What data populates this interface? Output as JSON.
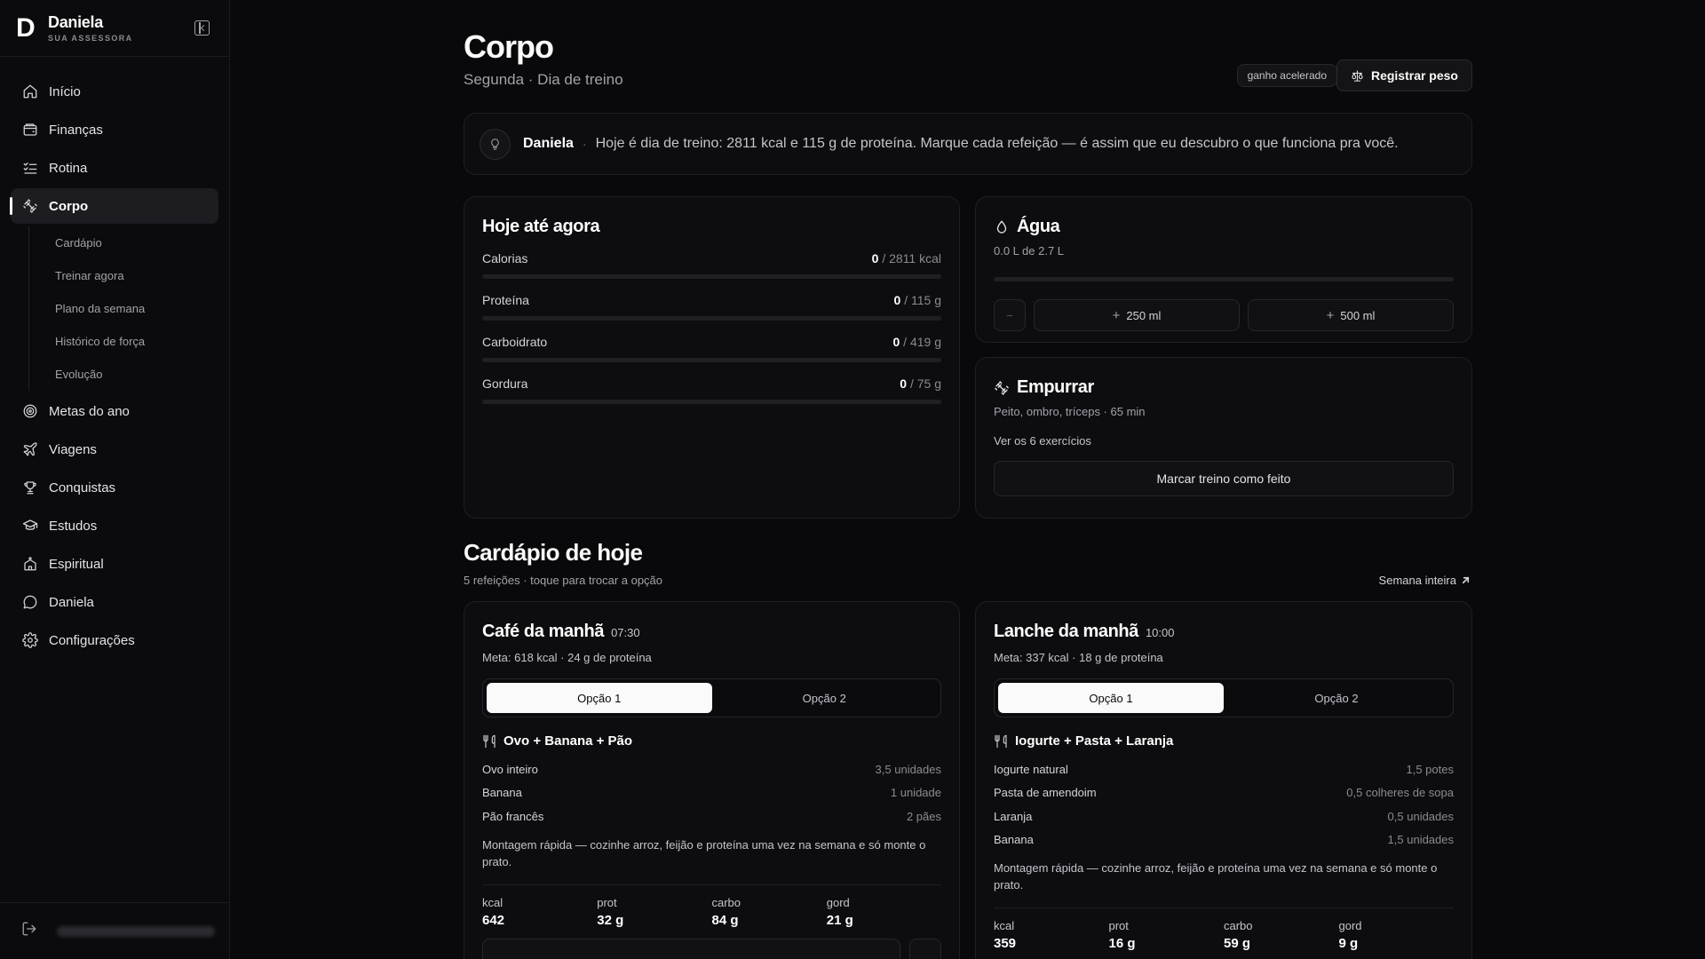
{
  "brand": {
    "logo": "D",
    "name": "Daniela",
    "subtitle": "SUA ASSESSORA"
  },
  "nav": {
    "items": [
      {
        "label": "Início",
        "icon": "home-icon"
      },
      {
        "label": "Finanças",
        "icon": "wallet-icon"
      },
      {
        "label": "Rotina",
        "icon": "checklist-icon"
      },
      {
        "label": "Corpo",
        "icon": "dumbbell-icon",
        "active": true
      },
      {
        "label": "Metas do ano",
        "icon": "target-icon"
      },
      {
        "label": "Viagens",
        "icon": "plane-icon"
      },
      {
        "label": "Conquistas",
        "icon": "trophy-icon"
      },
      {
        "label": "Estudos",
        "icon": "graduation-cap-icon"
      },
      {
        "label": "Espiritual",
        "icon": "temple-icon"
      },
      {
        "label": "Daniela",
        "icon": "chat-icon"
      },
      {
        "label": "Configurações",
        "icon": "gear-icon"
      }
    ],
    "sub_items": [
      "Cardápio",
      "Treinar agora",
      "Plano da semana",
      "Histórico de força",
      "Evolução"
    ]
  },
  "header": {
    "title": "Corpo",
    "subtitle": "Segunda · Dia de treino",
    "tag": "ganho acelerado",
    "register_weight": "Registrar peso"
  },
  "tip": {
    "name": "Daniela",
    "separator": "·",
    "message": "Hoje é dia de treino: 2811 kcal e 115 g de proteína. Marque cada refeição — é assim que eu descubro o que funciona pra você."
  },
  "today": {
    "title": "Hoje até agora",
    "macros": [
      {
        "label": "Calorias",
        "current": "0",
        "target": "/ 2811 kcal",
        "progress": 0
      },
      {
        "label": "Proteína",
        "current": "0",
        "target": "/ 115 g",
        "progress": 0
      },
      {
        "label": "Carboidrato",
        "current": "0",
        "target": "/ 419 g",
        "progress": 0
      },
      {
        "label": "Gordura",
        "current": "0",
        "target": "/ 75 g",
        "progress": 0
      }
    ]
  },
  "water": {
    "title": "Água",
    "subtitle": "0.0 L de 2.7 L",
    "progress": 0,
    "minus": "−",
    "plus": "+",
    "add_250": "250 ml",
    "add_500": "500 ml"
  },
  "workout": {
    "title": "Empurrar",
    "subtitle": "Peito, ombro, tríceps · 65 min",
    "link": "Ver os 6 exercícios",
    "done_button": "Marcar treino como feito"
  },
  "menu": {
    "title": "Cardápio de hoje",
    "subtitle": "5 refeições · toque para trocar a opção",
    "week_link": "Semana inteira",
    "meals": [
      {
        "name": "Café da manhã",
        "time": "07:30",
        "goal": "Meta: 618 kcal · 24 g de proteína",
        "options": [
          "Opção 1",
          "Opção 2"
        ],
        "dish": "Ovo + Banana + Pão",
        "ingredients": [
          {
            "name": "Ovo inteiro",
            "qty": "3,5 unidades"
          },
          {
            "name": "Banana",
            "qty": "1 unidade"
          },
          {
            "name": "Pão francês",
            "qty": "2 pães"
          }
        ],
        "note": "Montagem rápida — cozinhe arroz, feijão e proteína uma vez na semana e só monte o prato.",
        "stats": [
          {
            "label": "kcal",
            "value": "642"
          },
          {
            "label": "prot",
            "value": "32 g"
          },
          {
            "label": "carbo",
            "value": "84 g"
          },
          {
            "label": "gord",
            "value": "21 g"
          }
        ]
      },
      {
        "name": "Lanche da manhã",
        "time": "10:00",
        "goal": "Meta: 337 kcal · 18 g de proteína",
        "options": [
          "Opção 1",
          "Opção 2"
        ],
        "dish": "Iogurte + Pasta + Laranja",
        "ingredients": [
          {
            "name": "Iogurte natural",
            "qty": "1,5 potes"
          },
          {
            "name": "Pasta de amendoim",
            "qty": "0,5 colheres de sopa"
          },
          {
            "name": "Laranja",
            "qty": "0,5 unidades"
          },
          {
            "name": "Banana",
            "qty": "1,5 unidades"
          }
        ],
        "note": "Montagem rápida — cozinhe arroz, feijão e proteína uma vez na semana e só monte o prato.",
        "stats": [
          {
            "label": "kcal",
            "value": "359"
          },
          {
            "label": "prot",
            "value": "16 g"
          },
          {
            "label": "carbo",
            "value": "59 g"
          },
          {
            "label": "gord",
            "value": "9 g"
          }
        ]
      }
    ]
  }
}
